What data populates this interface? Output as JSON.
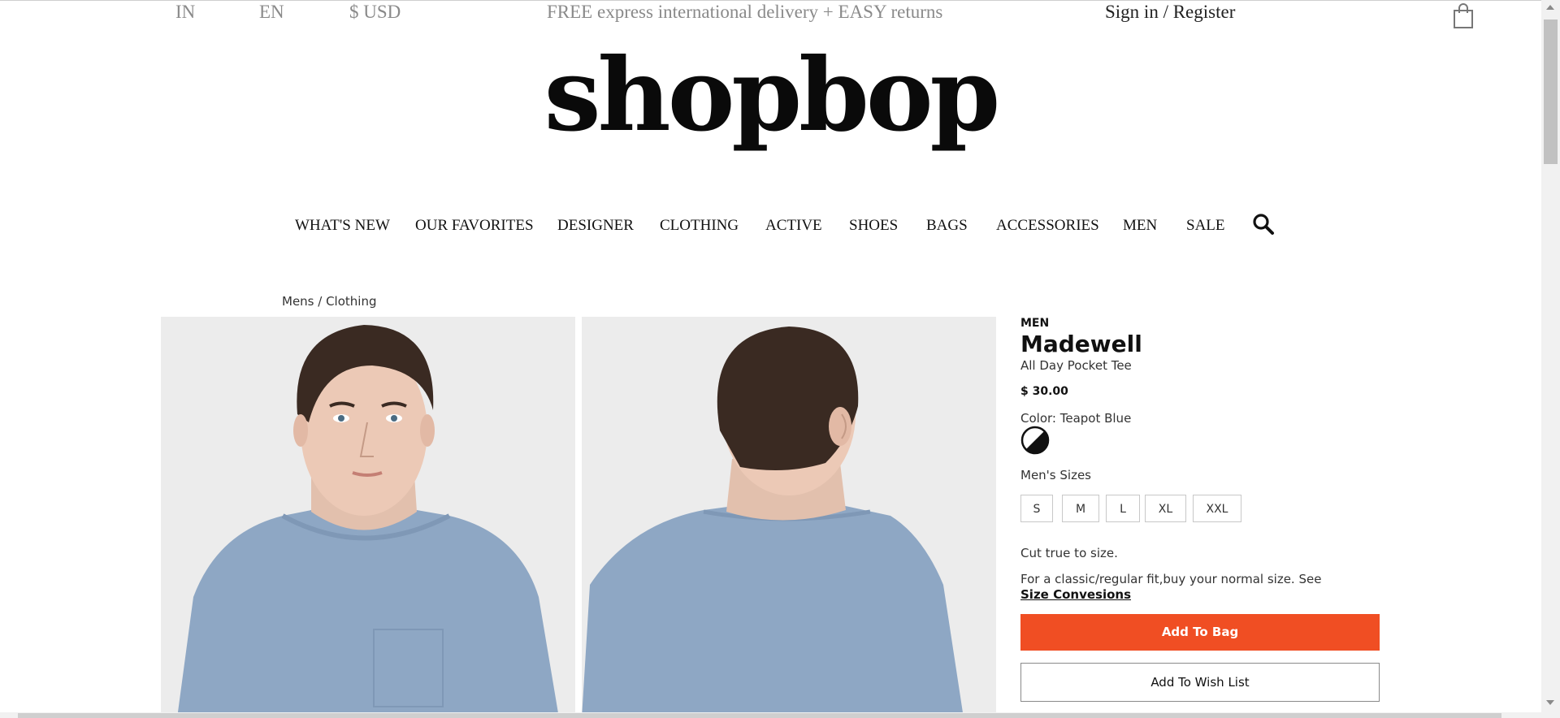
{
  "utility_bar": {
    "country": "IN",
    "language": "EN",
    "currency": "$ USD",
    "promo": "FREE express international delivery + EASY returns",
    "sign_in": "Sign in / Register",
    "bag_icon": "shopping-bag-icon"
  },
  "logo": {
    "text": "shopbop"
  },
  "nav": {
    "items": [
      "WHAT'S NEW",
      "OUR FAVORITES",
      "DESIGNER",
      "CLOTHING",
      "ACTIVE",
      "SHOES",
      "BAGS",
      "ACCESSORIES",
      "MEN",
      "SALE"
    ],
    "search_icon": "search-icon"
  },
  "breadcrumb": "Mens / Clothing",
  "product": {
    "department": "MEN",
    "brand": "Madewell",
    "name": "All Day Pocket Tee",
    "price": "$ 30.00",
    "color_label": "Color: Teapot Blue",
    "sizes_label": "Men's Sizes",
    "sizes": [
      "S",
      "M",
      "L",
      "XL",
      "XXL"
    ],
    "fit_note": "Cut true to size.",
    "fit_detail": "For a classic/regular fit,buy your normal size. See",
    "size_link": "Size Convesions",
    "add_to_bag": "Add To Bag",
    "add_to_wishlist": "Add To Wish List",
    "accent_color": "#f04e23"
  }
}
